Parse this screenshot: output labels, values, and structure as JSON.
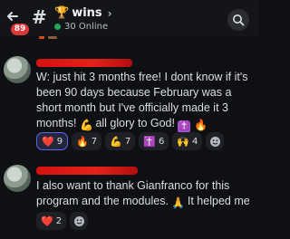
{
  "header": {
    "back_icon": "arrow-left-icon",
    "unread_badge": "89",
    "channel_hash": "#",
    "channel_emoji": "🏆",
    "channel_name": "wins",
    "chevron": "›",
    "online_text": "30 Online",
    "search_icon": "search-icon"
  },
  "messages": [
    {
      "text": "W: just hit 3 months free! I dont know if it's been 90 days because February was a short month but I've officially made it 3 months!",
      "text_tail": "all glory to God!",
      "inline_emojis": [
        "💪",
        "✝️",
        "🔥"
      ],
      "reactions": [
        {
          "emoji": "❤️",
          "count": "9",
          "selected": true
        },
        {
          "emoji": "🔥",
          "count": "7",
          "selected": false
        },
        {
          "emoji": "💪",
          "count": "7",
          "selected": false
        },
        {
          "emoji": "✝️",
          "count": "6",
          "selected": false
        },
        {
          "emoji": "🙌",
          "count": "4",
          "selected": false
        }
      ]
    },
    {
      "text": "I also want to thank Gianfranco for this program and the modules.",
      "text_tail": "It helped me a ton",
      "inline_emojis": [
        "🙏"
      ],
      "reactions": [
        {
          "emoji": "❤️",
          "count": "2",
          "selected": false
        }
      ]
    }
  ],
  "colors": {
    "background": "#0f1014",
    "badge": "#da373c",
    "online": "#23a55a",
    "accent": "#5865f2",
    "redaction": "#d4110f"
  }
}
